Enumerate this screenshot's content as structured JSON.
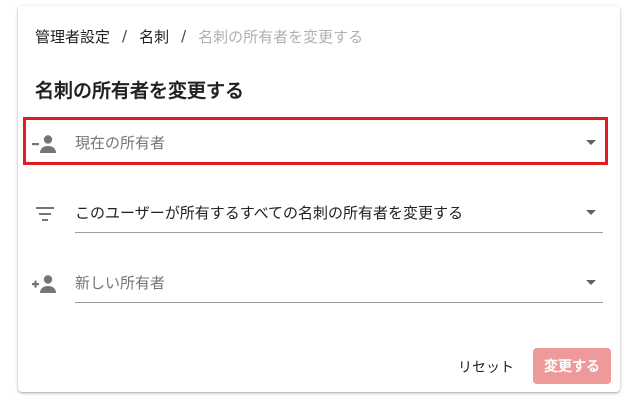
{
  "breadcrumb": {
    "items": [
      "管理者設定",
      "名刺"
    ],
    "separator": "/",
    "current": "名刺の所有者を変更する"
  },
  "page_title": "名刺の所有者を変更する",
  "fields": {
    "current_owner": {
      "placeholder": "現在の所有者",
      "icon": "person-remove-icon",
      "highlighted": true,
      "highlight_color": "#e31b23"
    },
    "scope": {
      "value": "このユーザーが所有するすべての名刺の所有者を変更する",
      "icon": "filter-list-icon"
    },
    "new_owner": {
      "placeholder": "新しい所有者",
      "icon": "person-add-icon"
    }
  },
  "actions": {
    "reset_label": "リセット",
    "submit_label": "変更する",
    "submit_enabled": false,
    "submit_color": "#ef9a9a"
  }
}
